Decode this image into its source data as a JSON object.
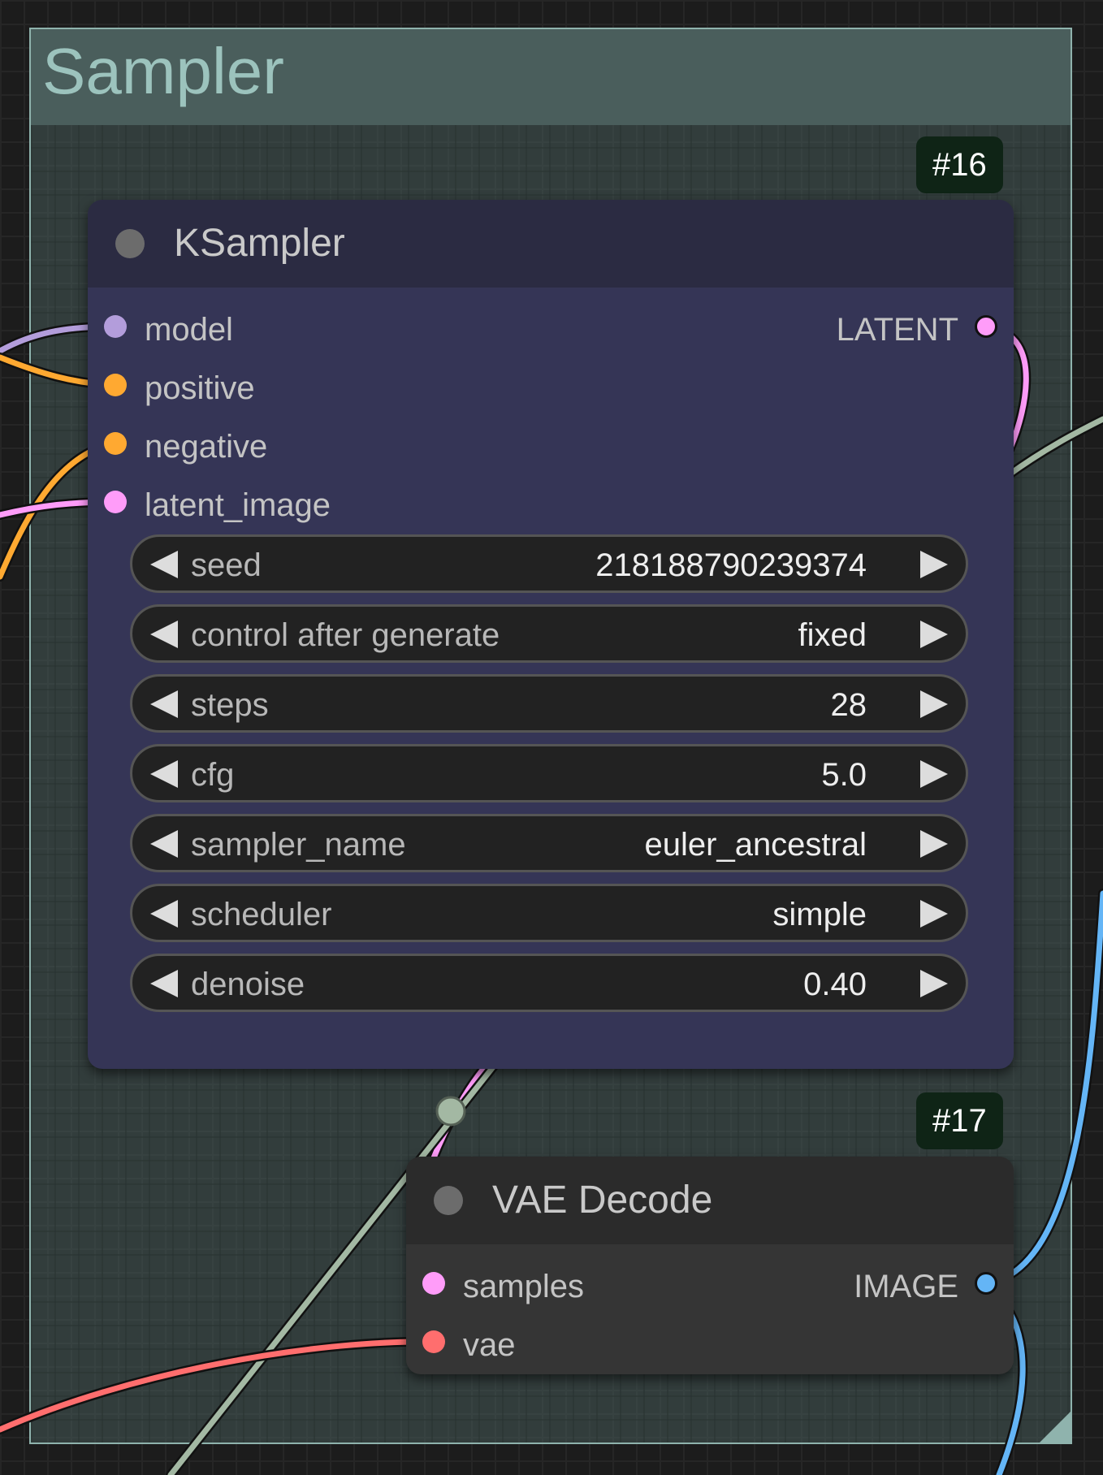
{
  "group": {
    "title": "Sampler"
  },
  "ksampler": {
    "id_badge": "#16",
    "title": "KSampler",
    "inputs": [
      {
        "label": "model",
        "color": "#b39ddb"
      },
      {
        "label": "positive",
        "color": "#ffa931"
      },
      {
        "label": "negative",
        "color": "#ffa931"
      },
      {
        "label": "latent_image",
        "color": "#ff9cf9"
      }
    ],
    "output": {
      "label": "LATENT",
      "color": "#ff9cf9"
    },
    "widgets": [
      {
        "label": "seed",
        "value": "218188790239374"
      },
      {
        "label": "control after generate",
        "value": "fixed"
      },
      {
        "label": "steps",
        "value": "28"
      },
      {
        "label": "cfg",
        "value": "5.0"
      },
      {
        "label": "sampler_name",
        "value": "euler_ancestral"
      },
      {
        "label": "scheduler",
        "value": "simple"
      },
      {
        "label": "denoise",
        "value": "0.40"
      }
    ]
  },
  "vae_decode": {
    "id_badge": "#17",
    "title": "VAE Decode",
    "inputs": [
      {
        "label": "samples",
        "color": "#ff9cf9"
      },
      {
        "label": "vae",
        "color": "#ff6e6e"
      }
    ],
    "output": {
      "label": "IMAGE",
      "color": "#64b5f6"
    }
  },
  "wire_colors": {
    "model": "#b39ddb",
    "conditioning": "#ffa931",
    "latent": "#ff9cf9",
    "vae": "#ff6e6e",
    "image": "#64b5f6",
    "reroute": "#a3b8a3"
  }
}
